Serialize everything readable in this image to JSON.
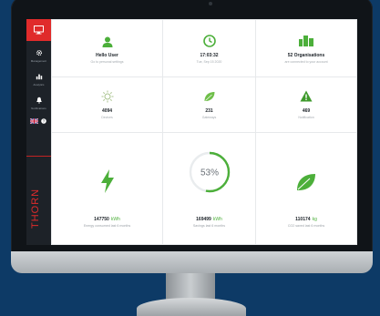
{
  "sidebar": {
    "items": [
      {
        "icon": "monitor-icon",
        "label": ""
      },
      {
        "icon": "gear-icon",
        "label": "Management"
      },
      {
        "icon": "analytics-icon",
        "label": "Analytics"
      },
      {
        "icon": "bell-icon",
        "label": "Notifications"
      }
    ],
    "brand": "THORN"
  },
  "tiles_top": [
    {
      "icon": "user-icon",
      "title": "Hello User",
      "sub": "Go to personal settings"
    },
    {
      "icon": "clock-icon",
      "title": "17:03:32",
      "sub": "Tue, Sep 15 2020"
    },
    {
      "icon": "buildings-icon",
      "title": "52 Organisations",
      "sub": "are connected to your account"
    }
  ],
  "tiles_mid": [
    {
      "icon": "sun-icon",
      "title": "4094",
      "sub": "Devices"
    },
    {
      "icon": "leaf-small-icon",
      "title": "231",
      "sub": "Gateways"
    },
    {
      "icon": "warning-icon",
      "title": "469",
      "sub": "Notification"
    }
  ],
  "tiles_big": [
    {
      "icon": "lightning-icon",
      "value": "147750",
      "unit": "kWh",
      "desc": "Energy consumed last 6 months"
    },
    {
      "icon": "progress-ring",
      "percent_label": "53%",
      "percent": 53,
      "value": "169499",
      "unit": "kWh",
      "desc": "Savings last 6 months"
    },
    {
      "icon": "leaf-icon",
      "value": "110174",
      "unit": "kg",
      "desc": "CO2 saved last 6 months"
    }
  ],
  "colors": {
    "accent": "#e02b2b",
    "green": "#4caf3a",
    "sidebar": "#1d2228",
    "background": "#0d3a66"
  }
}
